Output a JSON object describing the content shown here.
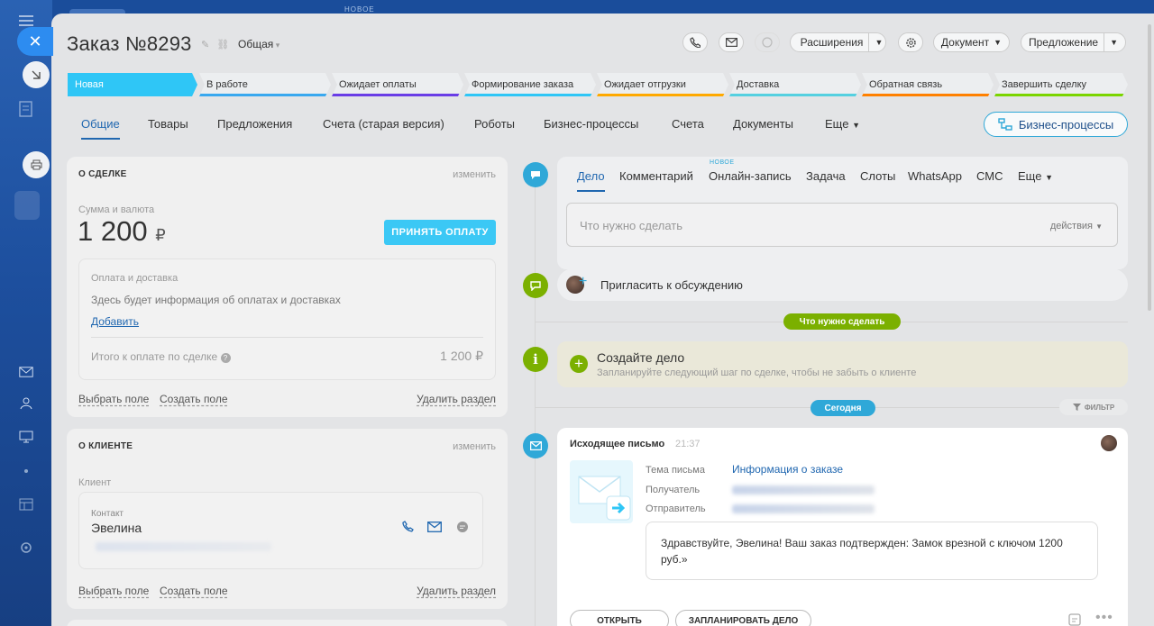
{
  "app": {
    "top_new_label": "НОВОЕ"
  },
  "header": {
    "title": "Заказ №8293",
    "category": "Общая",
    "extensions_label": "Расширения",
    "document_label": "Документ",
    "proposal_label": "Предложение"
  },
  "stages": [
    {
      "label": "Новая",
      "color": "#2fc6f6",
      "active": true
    },
    {
      "label": "В работе",
      "color": "#39a8ef"
    },
    {
      "label": "Ожидает оплаты",
      "color": "#6a3de6"
    },
    {
      "label": "Формирование заказа",
      "color": "#2fc6f6"
    },
    {
      "label": "Ожидает отгрузки",
      "color": "#ffa900"
    },
    {
      "label": "Доставка",
      "color": "#55d0e0"
    },
    {
      "label": "Обратная связь",
      "color": "#ff8000"
    },
    {
      "label": "Завершить сделку",
      "color": "#7bd500"
    }
  ],
  "tabs": [
    "Общие",
    "Товары",
    "Предложения",
    "Счета (старая версия)",
    "Роботы",
    "Бизнес-процессы",
    "Счета",
    "Документы",
    "Еще"
  ],
  "bp_button": "Бизнес-процессы",
  "deal_card": {
    "title": "О СДЕЛКЕ",
    "edit": "изменить",
    "amount_label": "Сумма и валюта",
    "amount": "1 200",
    "currency": "₽",
    "pay_button": "ПРИНЯТЬ ОПЛАТУ",
    "payment_title": "Оплата и доставка",
    "payment_info": "Здесь будет информация об оплатах и доставках",
    "add_link": "Добавить",
    "total_label": "Итого к оплате по сделке",
    "total_value": "1 200 ₽",
    "choose_field": "Выбрать поле",
    "create_field": "Создать поле",
    "delete_section": "Удалить раздел"
  },
  "client_card": {
    "title": "О КЛИЕНТЕ",
    "edit": "изменить",
    "client_label": "Клиент",
    "contact_label": "Контакт",
    "contact_name": "Эвелина",
    "choose_field": "Выбрать поле",
    "create_field": "Создать поле",
    "delete_section": "Удалить раздел"
  },
  "activity": {
    "tabs": [
      "Дело",
      "Комментарий",
      "Онлайн-запись",
      "Задача",
      "Слоты",
      "WhatsApp",
      "СМС",
      "Еще"
    ],
    "new_badge": "НОВОЕ",
    "placeholder": "Что нужно сделать",
    "actions": "действия"
  },
  "invite": "Пригласить к обсуждению",
  "todo_pill": "Что нужно сделать",
  "create_task": {
    "title": "Создайте дело",
    "subtitle": "Запланируйте следующий шаг по сделке, чтобы не забыть о клиенте"
  },
  "today_pill": "Сегодня",
  "filter_label": "ФИЛЬТР",
  "email": {
    "title": "Исходящее письмо",
    "time": "21:37",
    "subject_label": "Тема письма",
    "subject_value": "Информация о заказе",
    "recipient_label": "Получатель",
    "sender_label": "Отправитель",
    "body": "Здравствуйте, Эвелина! Ваш заказ подтвержден: Замок врезной с ключом 1200 руб.»",
    "open_button": "ОТКРЫТЬ",
    "schedule_button": "ЗАПЛАНИРОВАТЬ ДЕЛО"
  }
}
